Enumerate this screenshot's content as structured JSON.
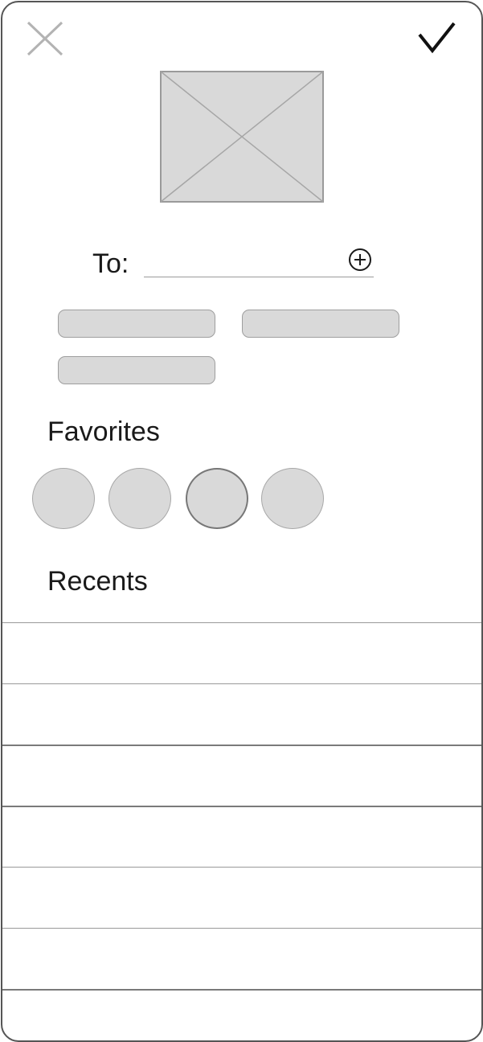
{
  "header": {
    "close_icon": "close-icon",
    "confirm_icon": "checkmark-icon"
  },
  "media": {
    "placeholder_icon": "image-placeholder-icon"
  },
  "recipient": {
    "label": "To:",
    "value": "",
    "add_icon": "plus-circle-icon"
  },
  "chips": [
    {
      "label": ""
    },
    {
      "label": ""
    },
    {
      "label": ""
    }
  ],
  "favorites": {
    "title": "Favorites",
    "count": 4,
    "selected_index": 2
  },
  "recents": {
    "title": "Recents",
    "row_count": 7
  },
  "colors": {
    "placeholder_fill": "#d9d9d9",
    "outline": "#555555",
    "divider": "#999999",
    "text": "#1a1a1a"
  }
}
